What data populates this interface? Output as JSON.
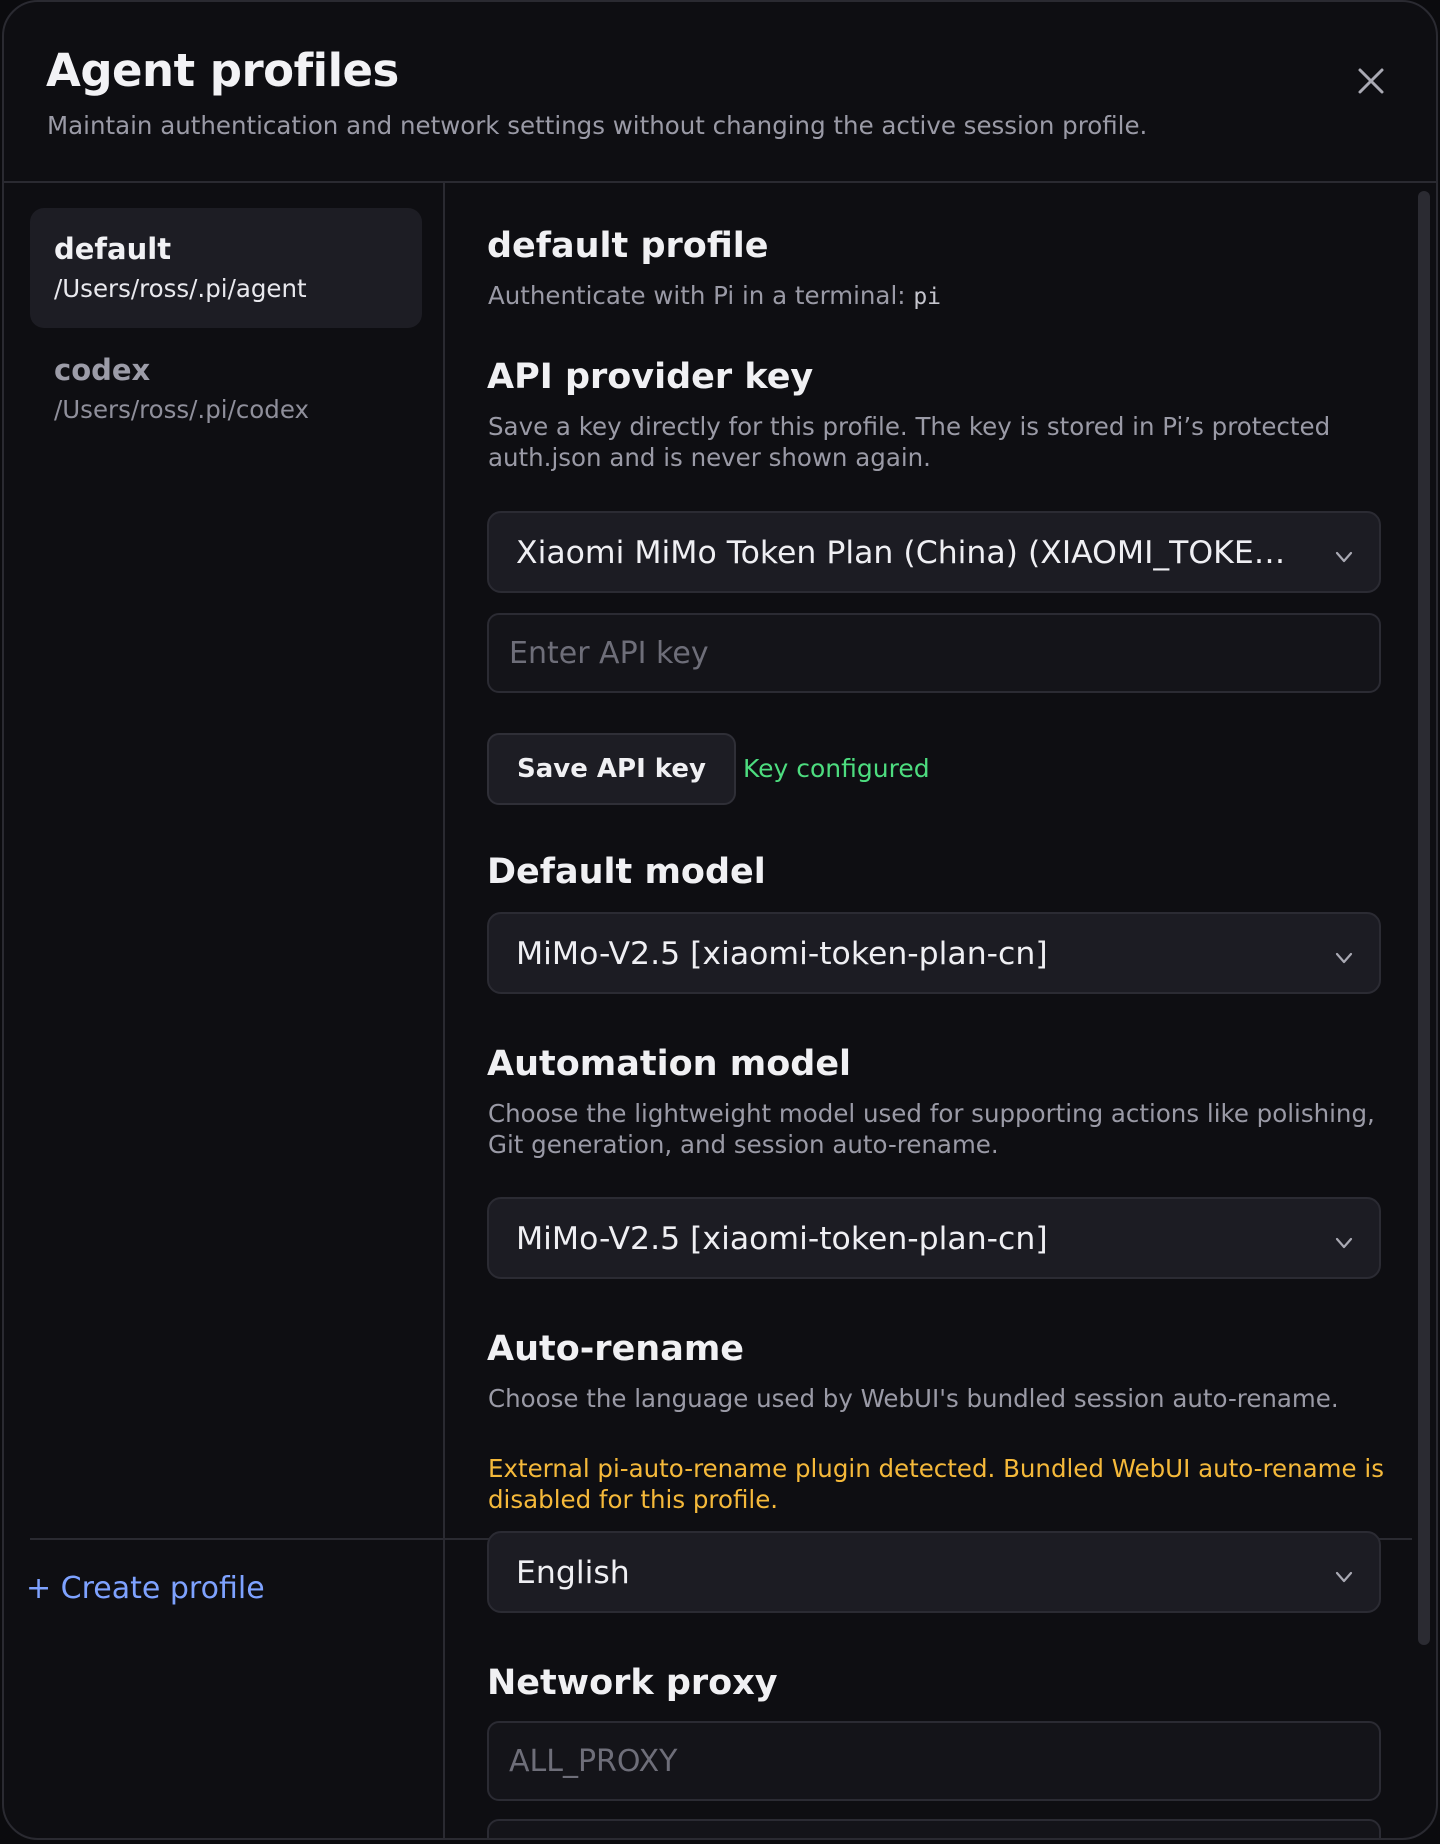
{
  "dialog": {
    "title": "Agent profiles",
    "subtitle": "Maintain authentication and network settings without changing the active session profile.",
    "close_icon": "close-icon"
  },
  "sidebar": {
    "profiles": [
      {
        "name": "default",
        "path": "/Users/ross/.pi/agent",
        "active": true
      },
      {
        "name": "codex",
        "path": "/Users/ross/.pi/codex",
        "active": false
      }
    ],
    "create_label": "+ Create profile"
  },
  "profile": {
    "title": "default profile",
    "auth_hint_text": "Authenticate with Pi in a terminal:",
    "auth_hint_command": "pi"
  },
  "api_key": {
    "title": "API provider key",
    "description": "Save a key directly for this profile. The key is stored in Pi’s protected auth.json and is never shown again.",
    "provider_selected": "Xiaomi MiMo Token Plan (China) (XIAOMI_TOKEN_PLAN_CN_API_KEY)",
    "input_placeholder": "Enter API key",
    "input_value": "",
    "save_label": "Save API key",
    "status": "Key configured"
  },
  "default_model": {
    "title": "Default model",
    "selected": "MiMo-V2.5 [xiaomi-token-plan-cn]"
  },
  "automation_model": {
    "title": "Automation model",
    "description": "Choose the lightweight model used for supporting actions like polishing, Git generation, and session auto-rename.",
    "selected": "MiMo-V2.5 [xiaomi-token-plan-cn]"
  },
  "auto_rename": {
    "title": "Auto-rename",
    "description": "Choose the language used by WebUI's bundled session auto-rename.",
    "warning": "External pi-auto-rename plugin detected. Bundled WebUI auto-rename is disabled for this profile.",
    "language_selected": "English"
  },
  "network_proxy": {
    "title": "Network proxy",
    "all_proxy_placeholder": "ALL_PROXY",
    "all_proxy_value": ""
  },
  "colors": {
    "accent": "#7ea2ff",
    "success": "#4ddc7f",
    "warning": "#f5b93a",
    "background": "#0e0e12"
  }
}
